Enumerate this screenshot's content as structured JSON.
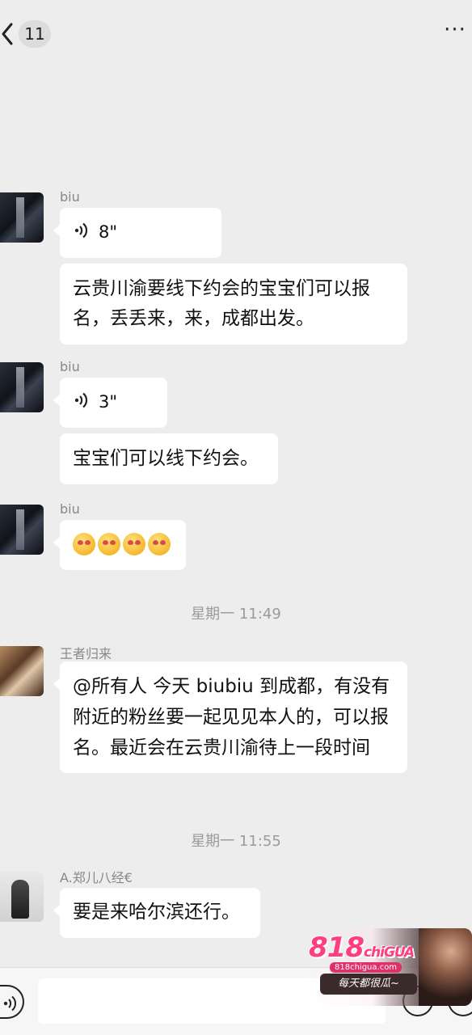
{
  "header": {
    "unread_count": "11",
    "more_label": "···"
  },
  "messages": [
    {
      "sender": "biu",
      "voice": "8\"",
      "text": "云贵川渝要线下约会的宝宝们可以报名，丢丢来，来，成都出发。"
    },
    {
      "sender": "biu",
      "voice": "3\"",
      "text": "宝宝们可以线下约会。"
    },
    {
      "sender": "biu",
      "emoji_count": 4
    },
    {
      "timestamp": "星期一 11:49"
    },
    {
      "sender": "王者归来",
      "text": "@所有人 今天 biubiu 到成都，有没有附近的粉丝要一起见见本人的，可以报名。最近会在云贵川渝待上一段时间"
    },
    {
      "timestamp": "星期一 11:55"
    },
    {
      "sender": "A.郑儿八经€",
      "text": "要是来哈尔滨还行。"
    }
  ],
  "watermark": {
    "logo": "818",
    "logo_suffix": "chiGUA",
    "domain": "818chigua.com",
    "slogan": "每天都很瓜~"
  },
  "icons": {
    "back": "chevron-left-icon",
    "voice": "voice-wave-icon",
    "emoji": "heart-eyes-emoji-icon",
    "input_voice": "voice-input-icon",
    "input_emoji": "emoji-icon",
    "input_plus": "plus-icon"
  }
}
